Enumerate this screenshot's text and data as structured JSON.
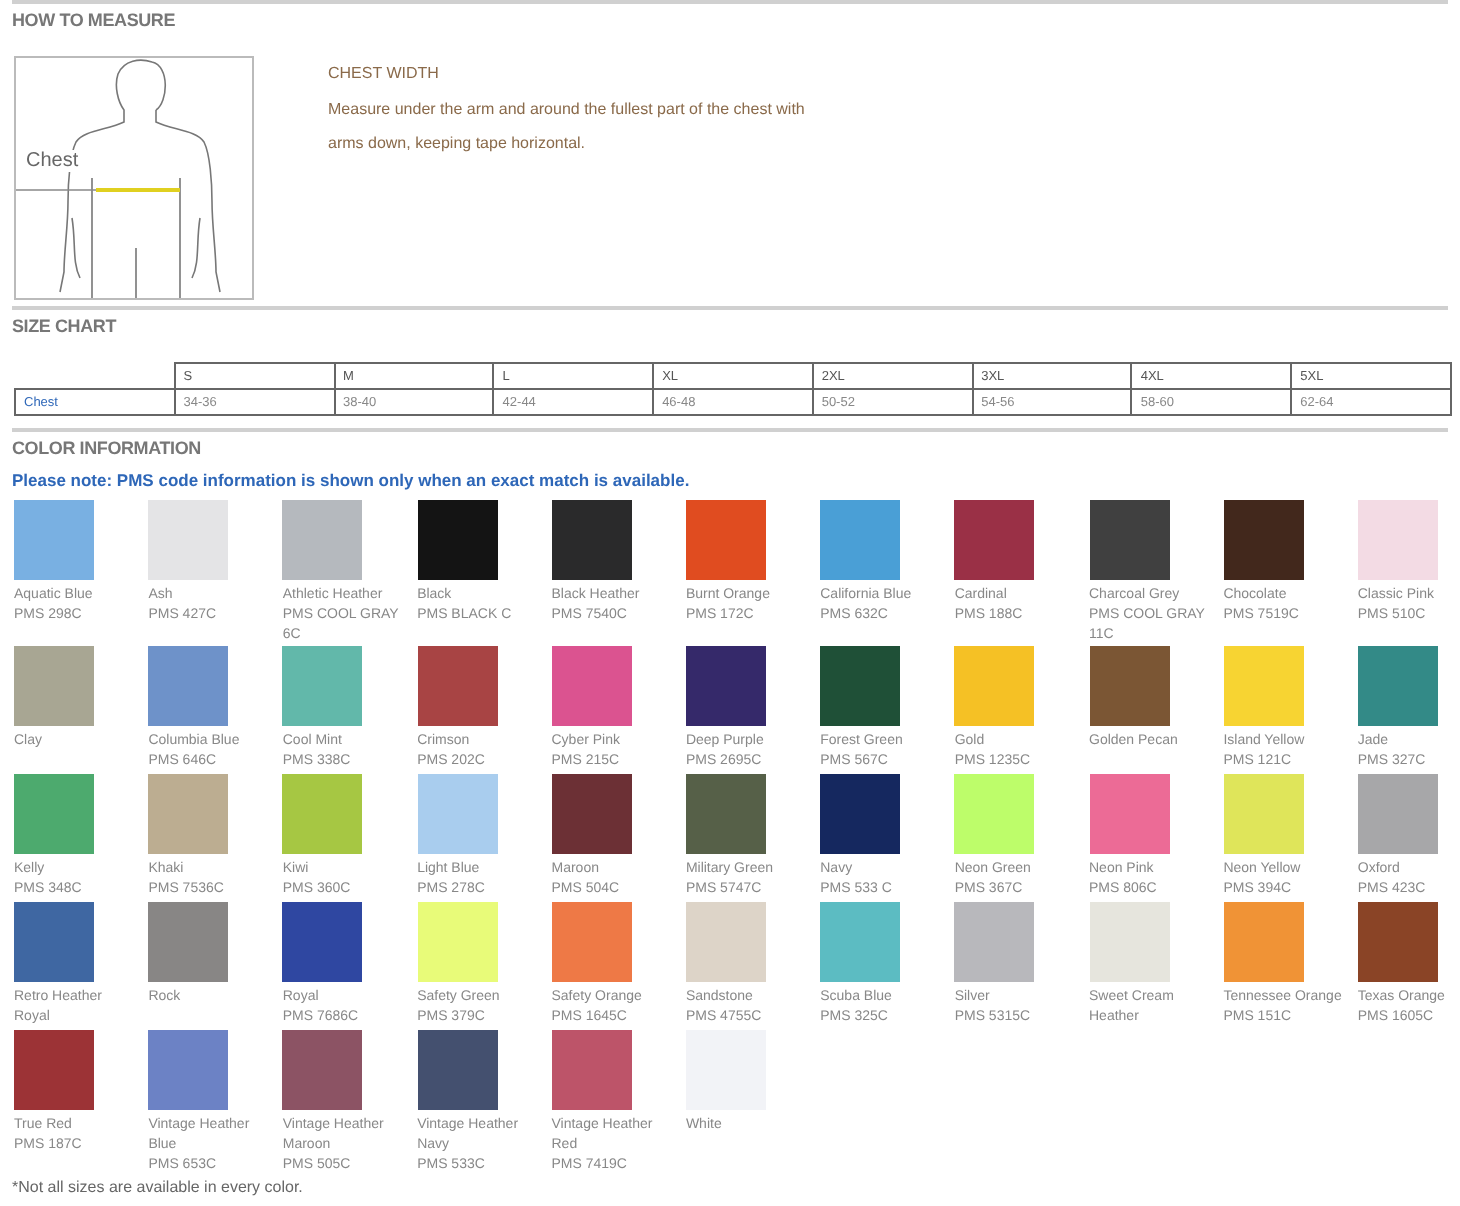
{
  "measure": {
    "heading": "HOW TO MEASURE",
    "figure_label": "Chest",
    "title": "CHEST WIDTH",
    "text": "Measure under the arm and around the fullest part of the chest with arms down, keeping tape horizontal."
  },
  "size_chart": {
    "heading": "SIZE CHART",
    "columns": [
      "S",
      "M",
      "L",
      "XL",
      "2XL",
      "3XL",
      "4XL",
      "5XL"
    ],
    "rows": [
      {
        "label": "Chest",
        "values": [
          "34-36",
          "38-40",
          "42-44",
          "46-48",
          "50-52",
          "54-56",
          "58-60",
          "62-64"
        ]
      }
    ]
  },
  "colors": {
    "heading": "COLOR INFORMATION",
    "note": "Please note: PMS code information is shown only when an exact match is available.",
    "rows": [
      [
        {
          "name": "Aquatic Blue",
          "pms": "PMS 298C",
          "color": "#79b0e2"
        },
        {
          "name": "Ash",
          "pms": "PMS 427C",
          "color": "#e4e4e6"
        },
        {
          "name": "Athletic Heather",
          "pms": "PMS COOL GRAY 6C",
          "color": "#b5b9be"
        },
        {
          "name": "Black",
          "pms": "PMS BLACK C",
          "color": "#141414"
        },
        {
          "name": "Black Heather",
          "pms": "PMS 7540C",
          "color": "#2a2a2b"
        },
        {
          "name": "Burnt Orange",
          "pms": "PMS 172C",
          "color": "#e04c20"
        },
        {
          "name": "California Blue",
          "pms": "PMS 632C",
          "color": "#4a9fd6"
        },
        {
          "name": "Cardinal",
          "pms": "PMS 188C",
          "color": "#9a3046"
        },
        {
          "name": "Charcoal Grey",
          "pms": "PMS COOL GRAY 11C",
          "color": "#404040"
        },
        {
          "name": "Chocolate",
          "pms": "PMS 7519C",
          "color": "#42281c"
        },
        {
          "name": "Classic Pink",
          "pms": "PMS 510C",
          "color": "#f3dbe4"
        }
      ],
      [
        {
          "name": "Clay",
          "color": "#a8a693"
        },
        {
          "name": "Columbia Blue",
          "pms": "PMS 646C",
          "color": "#6e92c9"
        },
        {
          "name": "Cool Mint",
          "pms": "PMS 338C",
          "color": "#62b8aa"
        },
        {
          "name": "Crimson",
          "pms": "PMS 202C",
          "color": "#a84444"
        },
        {
          "name": "Cyber Pink",
          "pms": "PMS 215C",
          "color": "#db5390"
        },
        {
          "name": "Deep Purple",
          "pms": "PMS 2695C",
          "color": "#35296a"
        },
        {
          "name": "Forest Green",
          "pms": "PMS 567C",
          "color": "#1f5037"
        },
        {
          "name": "Gold",
          "pms": "PMS 1235C",
          "color": "#f5c125"
        },
        {
          "name": "Golden Pecan",
          "color": "#7b5634"
        },
        {
          "name": "Island Yellow",
          "pms": "PMS 121C",
          "color": "#f7d432"
        },
        {
          "name": "Jade",
          "pms": "PMS 327C",
          "color": "#338a87"
        }
      ],
      [
        {
          "name": "Kelly",
          "pms": "PMS 348C",
          "color": "#4daa6e"
        },
        {
          "name": "Khaki",
          "pms": "PMS 7536C",
          "color": "#bcad91"
        },
        {
          "name": "Kiwi",
          "pms": "PMS 360C",
          "color": "#a6c743"
        },
        {
          "name": "Light Blue",
          "pms": "PMS 278C",
          "color": "#a9cdee"
        },
        {
          "name": "Maroon",
          "pms": "PMS 504C",
          "color": "#6c3035"
        },
        {
          "name": "Military Green",
          "pms": "PMS 5747C",
          "color": "#566048"
        },
        {
          "name": "Navy",
          "pms": "PMS 533 C",
          "color": "#15285f"
        },
        {
          "name": "Neon Green",
          "pms": "PMS 367C",
          "color": "#bdfd6a"
        },
        {
          "name": "Neon Pink",
          "pms": "PMS 806C",
          "color": "#ec6b96"
        },
        {
          "name": "Neon Yellow",
          "pms": "PMS 394C",
          "color": "#dfe55a"
        },
        {
          "name": "Oxford",
          "pms": "PMS 423C",
          "color": "#a7a7a9"
        }
      ],
      [
        {
          "name": "Retro Heather Royal",
          "color": "#3f67a2"
        },
        {
          "name": "Rock",
          "color": "#888685"
        },
        {
          "name": "Royal",
          "pms": "PMS 7686C",
          "color": "#2f47a1"
        },
        {
          "name": "Safety Green",
          "pms": "PMS 379C",
          "color": "#e8fb79"
        },
        {
          "name": "Safety Orange",
          "pms": "PMS 1645C",
          "color": "#ee7946"
        },
        {
          "name": "Sandstone",
          "pms": "PMS 4755C",
          "color": "#ddd4c8"
        },
        {
          "name": "Scuba Blue",
          "pms": "PMS 325C",
          "color": "#5cbcc2"
        },
        {
          "name": "Silver",
          "pms": "PMS 5315C",
          "color": "#b8b8bc"
        },
        {
          "name": "Sweet Cream Heather",
          "color": "#e6e5dd"
        },
        {
          "name": "Tennessee Orange",
          "pms": "PMS 151C",
          "color": "#f09336"
        },
        {
          "name": "Texas Orange",
          "pms": "PMS 1605C",
          "color": "#8a4426"
        }
      ],
      [
        {
          "name": "True Red",
          "pms": "PMS 187C",
          "color": "#9c3336"
        },
        {
          "name": "Vintage Heather Blue",
          "pms": "PMS 653C",
          "color": "#6c82c5"
        },
        {
          "name": "Vintage Heather Maroon",
          "pms": "PMS 505C",
          "color": "#8c5364"
        },
        {
          "name": "Vintage Heather Navy",
          "pms": "PMS 533C",
          "color": "#44506f"
        },
        {
          "name": "Vintage Heather Red",
          "pms": "PMS 7419C",
          "color": "#bd5469"
        },
        {
          "name": "White",
          "color": "#f2f3f7"
        }
      ]
    ],
    "footnote": "*Not all sizes are available in every color."
  }
}
